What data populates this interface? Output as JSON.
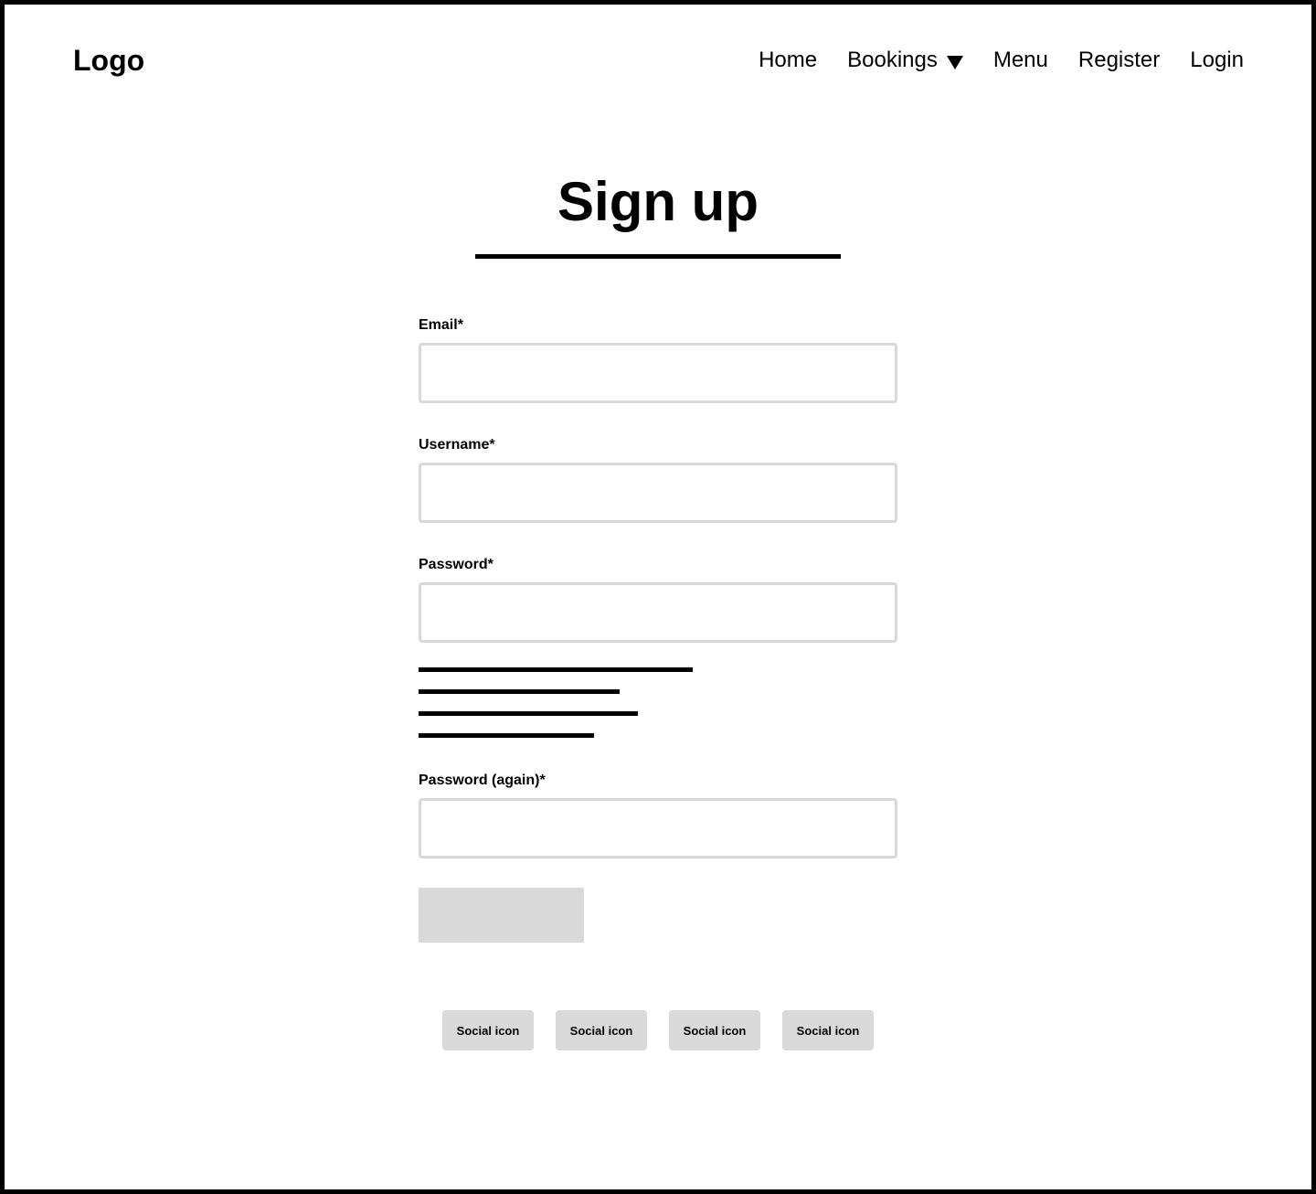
{
  "header": {
    "logo": "Logo",
    "nav": {
      "home": "Home",
      "bookings": "Bookings",
      "menu": "Menu",
      "register": "Register",
      "login": "Login"
    }
  },
  "page": {
    "title": "Sign up"
  },
  "form": {
    "email": {
      "label": "Email*",
      "value": ""
    },
    "username": {
      "label": "Username*",
      "value": ""
    },
    "password": {
      "label": "Password*",
      "value": ""
    },
    "password_again": {
      "label": "Password (again)*",
      "value": ""
    },
    "submit_label": ""
  },
  "social": {
    "icons": [
      "Social icon",
      "Social icon",
      "Social icon",
      "Social icon"
    ]
  },
  "colors": {
    "border": "#000000",
    "input_border": "#d9d9d9",
    "placeholder_fill": "#d9d9d9",
    "text": "#000000"
  }
}
